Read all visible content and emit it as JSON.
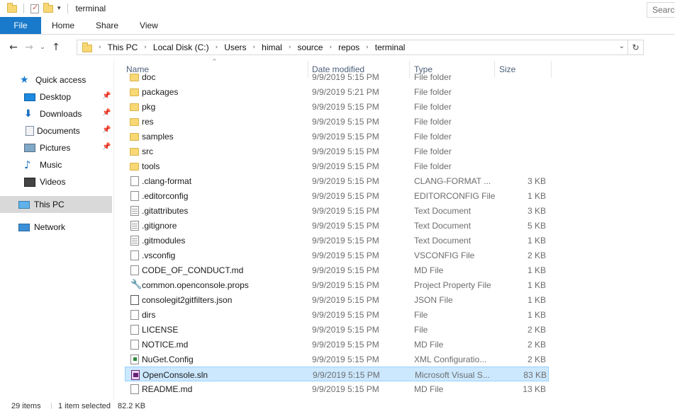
{
  "window": {
    "title": "terminal"
  },
  "ribbon": {
    "tabs": [
      "File",
      "Home",
      "Share",
      "View"
    ],
    "active_tab": "File",
    "accent_color": "#1979ca"
  },
  "address_bar": {
    "crumbs": [
      "This PC",
      "Local Disk (C:)",
      "Users",
      "himal",
      "source",
      "repos",
      "terminal"
    ]
  },
  "search": {
    "placeholder": "Search"
  },
  "nav_pane": {
    "quick_access": {
      "label": "Quick access",
      "icon": "star-icon"
    },
    "items": [
      {
        "label": "Desktop",
        "icon": "desktop-icon",
        "pinned": true
      },
      {
        "label": "Downloads",
        "icon": "download-icon",
        "pinned": true
      },
      {
        "label": "Documents",
        "icon": "document-icon",
        "pinned": true
      },
      {
        "label": "Pictures",
        "icon": "pictures-icon",
        "pinned": true
      },
      {
        "label": "Music",
        "icon": "music-icon",
        "pinned": false
      },
      {
        "label": "Videos",
        "icon": "videos-icon",
        "pinned": false
      }
    ],
    "this_pc": {
      "label": "This PC",
      "icon": "this-pc-icon",
      "selected": true
    },
    "network": {
      "label": "Network",
      "icon": "network-icon"
    }
  },
  "file_list": {
    "columns": [
      "Name",
      "Date modified",
      "Type",
      "Size"
    ],
    "sorted_by": "Name",
    "rows": [
      {
        "name": "doc",
        "date": "9/9/2019 5:15 PM",
        "type": "File folder",
        "size": "",
        "icon": "folder"
      },
      {
        "name": "packages",
        "date": "9/9/2019 5:21 PM",
        "type": "File folder",
        "size": "",
        "icon": "folder"
      },
      {
        "name": "pkg",
        "date": "9/9/2019 5:15 PM",
        "type": "File folder",
        "size": "",
        "icon": "folder"
      },
      {
        "name": "res",
        "date": "9/9/2019 5:15 PM",
        "type": "File folder",
        "size": "",
        "icon": "folder"
      },
      {
        "name": "samples",
        "date": "9/9/2019 5:15 PM",
        "type": "File folder",
        "size": "",
        "icon": "folder"
      },
      {
        "name": "src",
        "date": "9/9/2019 5:15 PM",
        "type": "File folder",
        "size": "",
        "icon": "folder"
      },
      {
        "name": "tools",
        "date": "9/9/2019 5:15 PM",
        "type": "File folder",
        "size": "",
        "icon": "folder"
      },
      {
        "name": ".clang-format",
        "date": "9/9/2019 5:15 PM",
        "type": "CLANG-FORMAT ...",
        "size": "3 KB",
        "icon": "file"
      },
      {
        "name": ".editorconfig",
        "date": "9/9/2019 5:15 PM",
        "type": "EDITORCONFIG File",
        "size": "1 KB",
        "icon": "file"
      },
      {
        "name": ".gitattributes",
        "date": "9/9/2019 5:15 PM",
        "type": "Text Document",
        "size": "3 KB",
        "icon": "text"
      },
      {
        "name": ".gitignore",
        "date": "9/9/2019 5:15 PM",
        "type": "Text Document",
        "size": "5 KB",
        "icon": "text"
      },
      {
        "name": ".gitmodules",
        "date": "9/9/2019 5:15 PM",
        "type": "Text Document",
        "size": "1 KB",
        "icon": "text"
      },
      {
        "name": ".vsconfig",
        "date": "9/9/2019 5:15 PM",
        "type": "VSCONFIG File",
        "size": "2 KB",
        "icon": "file"
      },
      {
        "name": "CODE_OF_CONDUCT.md",
        "date": "9/9/2019 5:15 PM",
        "type": "MD File",
        "size": "1 KB",
        "icon": "file"
      },
      {
        "name": "common.openconsole.props",
        "date": "9/9/2019 5:15 PM",
        "type": "Project Property File",
        "size": "1 KB",
        "icon": "wrench"
      },
      {
        "name": "consolegit2gitfilters.json",
        "date": "9/9/2019 5:15 PM",
        "type": "JSON File",
        "size": "1 KB",
        "icon": "json"
      },
      {
        "name": "dirs",
        "date": "9/9/2019 5:15 PM",
        "type": "File",
        "size": "1 KB",
        "icon": "file"
      },
      {
        "name": "LICENSE",
        "date": "9/9/2019 5:15 PM",
        "type": "File",
        "size": "2 KB",
        "icon": "file"
      },
      {
        "name": "NOTICE.md",
        "date": "9/9/2019 5:15 PM",
        "type": "MD File",
        "size": "2 KB",
        "icon": "file"
      },
      {
        "name": "NuGet.Config",
        "date": "9/9/2019 5:15 PM",
        "type": "XML Configuratio...",
        "size": "2 KB",
        "icon": "xml"
      },
      {
        "name": "OpenConsole.sln",
        "date": "9/9/2019 5:15 PM",
        "type": "Microsoft Visual S...",
        "size": "83 KB",
        "icon": "sln",
        "selected": true
      },
      {
        "name": "README.md",
        "date": "9/9/2019 5:15 PM",
        "type": "MD File",
        "size": "13 KB",
        "icon": "file"
      }
    ]
  },
  "status_bar": {
    "item_count": "29 items",
    "selection": "1 item selected",
    "selection_size": "82.2 KB"
  }
}
